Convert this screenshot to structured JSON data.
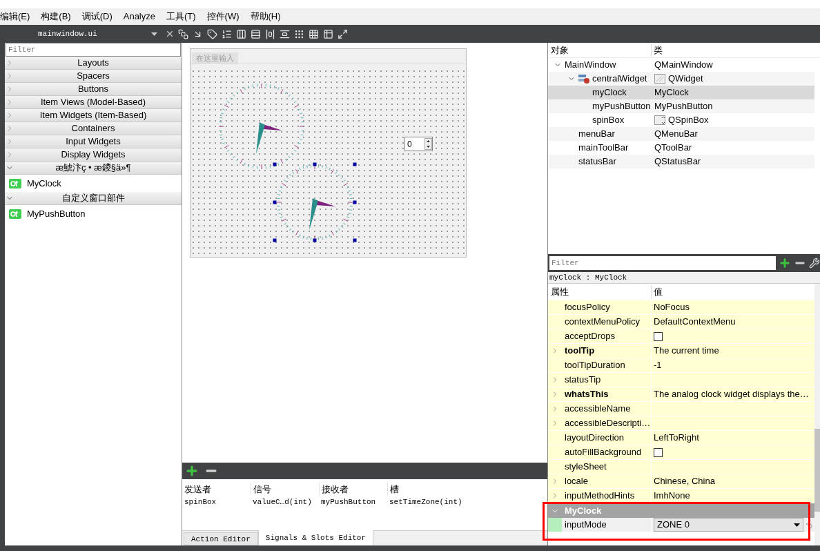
{
  "menu": [
    "编辑(E)",
    "构建(B)",
    "调试(D)",
    "Analyze",
    "工具(T)",
    "控件(W)",
    "帮助(H)"
  ],
  "toolbar": {
    "file": "mainwindow.ui"
  },
  "widget_box": {
    "filter_placeholder": "Filter",
    "categories": [
      {
        "label": "Layouts",
        "expanded": false
      },
      {
        "label": "Spacers",
        "expanded": false
      },
      {
        "label": "Buttons",
        "expanded": false
      },
      {
        "label": "Item Views (Model-Based)",
        "expanded": false
      },
      {
        "label": "Item Widgets (Item-Based)",
        "expanded": false
      },
      {
        "label": "Containers",
        "expanded": false
      },
      {
        "label": "Input Widgets",
        "expanded": false
      },
      {
        "label": "Display Widgets",
        "expanded": false
      },
      {
        "label": "æ鯱汴ç • æ鑁§ä»¶",
        "expanded": true,
        "items": [
          "MyClock"
        ]
      },
      {
        "label": "自定义窗口部件",
        "expanded": true,
        "items": [
          "MyPushButton"
        ]
      }
    ]
  },
  "form": {
    "menu_placeholder": "在这里输入",
    "spinbox_value": "0",
    "clocks": [
      {
        "selected": false
      },
      {
        "selected": true
      }
    ]
  },
  "signals": {
    "columns": [
      "发送者",
      "信号",
      "接收者",
      "槽"
    ],
    "rows": [
      [
        "spinBox",
        "valueC…d(int)",
        "myPushButton",
        "setTimeZone(int)"
      ]
    ],
    "tabs": [
      {
        "label": "Action Editor",
        "selected": false
      },
      {
        "label": "Signals & Slots Editor",
        "selected": true
      }
    ]
  },
  "object_inspector": {
    "columns": [
      "对象",
      "类"
    ],
    "tree": [
      {
        "name": "MainWindow",
        "class": "QMainWindow",
        "selected": false,
        "expanded": true,
        "children": [
          {
            "name": "centralWidget",
            "class": "QWidget",
            "kind": "layout",
            "selected": false,
            "expanded": true,
            "children": [
              {
                "name": "myClock",
                "class": "MyClock",
                "selected": true
              },
              {
                "name": "myPushButton",
                "class": "MyPushButton",
                "selected": false
              },
              {
                "name": "spinBox",
                "class": "QSpinBox",
                "kind": "spinbox",
                "selected": false
              }
            ]
          },
          {
            "name": "menuBar",
            "class": "QMenuBar",
            "selected": false
          },
          {
            "name": "mainToolBar",
            "class": "QToolBar",
            "selected": false
          },
          {
            "name": "statusBar",
            "class": "QStatusBar",
            "selected": false
          }
        ]
      }
    ]
  },
  "property_editor": {
    "filter_placeholder": "Filter",
    "object_label": "myClock : MyClock",
    "columns": [
      "属性",
      "值"
    ],
    "properties": [
      {
        "name": "focusPolicy",
        "kind": "text",
        "value": "NoFocus",
        "bold": false,
        "expandable": false
      },
      {
        "name": "contextMenuPolicy",
        "kind": "text",
        "value": "DefaultContextMenu",
        "bold": false,
        "expandable": false
      },
      {
        "name": "acceptDrops",
        "kind": "checkbox",
        "checked": false,
        "bold": false,
        "expandable": false
      },
      {
        "name": "toolTip",
        "kind": "text",
        "value": "The current time",
        "bold": true,
        "expandable": true
      },
      {
        "name": "toolTipDuration",
        "kind": "text",
        "value": "-1",
        "bold": false,
        "expandable": false
      },
      {
        "name": "statusTip",
        "kind": "text",
        "bold": false,
        "expandable": true
      },
      {
        "name": "whatsThis",
        "kind": "text",
        "value": "The analog clock widget displays the…",
        "bold": true,
        "expandable": true
      },
      {
        "name": "accessibleName",
        "kind": "text",
        "bold": false,
        "expandable": true
      },
      {
        "name": "accessibleDescripti…",
        "kind": "text",
        "bold": false,
        "expandable": true
      },
      {
        "name": "layoutDirection",
        "kind": "text",
        "value": "LeftToRight",
        "bold": false,
        "expandable": false
      },
      {
        "name": "autoFillBackground",
        "kind": "checkbox",
        "checked": false,
        "bold": false,
        "expandable": false
      },
      {
        "name": "styleSheet",
        "kind": "text",
        "bold": false,
        "expandable": false
      },
      {
        "name": "locale",
        "kind": "text",
        "value": "Chinese, China",
        "bold": false,
        "expandable": true
      },
      {
        "name": "inputMethodHints",
        "kind": "text",
        "value": "ImhNone",
        "bold": false,
        "expandable": true
      }
    ],
    "sections": [
      {
        "title": "MyClock",
        "expanded": true,
        "properties": [
          {
            "name": "inputMode",
            "kind": "combo",
            "value": "ZONE 0"
          }
        ]
      }
    ]
  }
}
